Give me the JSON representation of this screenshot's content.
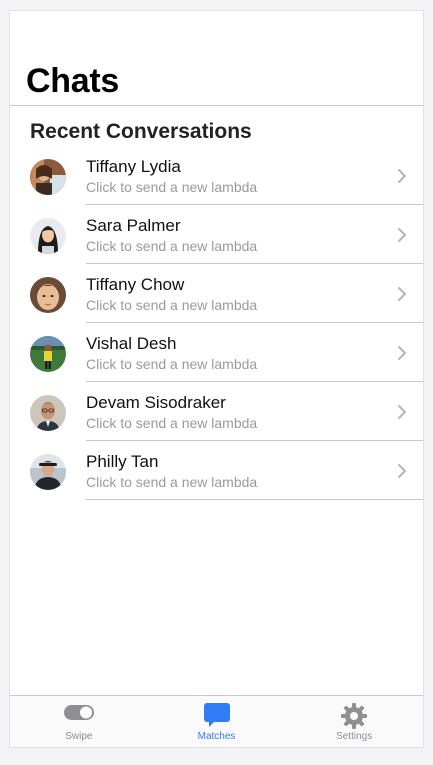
{
  "header": {
    "title": "Chats"
  },
  "section": {
    "title": "Recent Conversations"
  },
  "chats": [
    {
      "name": "Tiffany Lydia",
      "preview": "Click to send a new lambda",
      "avatar": "avatar-photo"
    },
    {
      "name": "Sara Palmer",
      "preview": "Click to send a new lambda",
      "avatar": "avatar-photo"
    },
    {
      "name": "Tiffany Chow",
      "preview": "Click to send a new lambda",
      "avatar": "avatar-photo"
    },
    {
      "name": "Vishal Desh",
      "preview": "Click to send a new lambda",
      "avatar": "avatar-photo"
    },
    {
      "name": "Devam Sisodraker",
      "preview": "Click to send a new lambda",
      "avatar": "avatar-photo"
    },
    {
      "name": "Philly Tan",
      "preview": "Click to send a new lambda",
      "avatar": "avatar-photo"
    }
  ],
  "tabs": [
    {
      "label": "Swipe",
      "icon": "toggle-icon",
      "active": false
    },
    {
      "label": "Matches",
      "icon": "chat-bubble-icon",
      "active": true
    },
    {
      "label": "Settings",
      "icon": "gear-icon",
      "active": false
    }
  ],
  "colors": {
    "accent": "#2f7cf6",
    "inactive": "#8e8e93",
    "divider": "#c8c8cc",
    "background": "#ffffff"
  }
}
